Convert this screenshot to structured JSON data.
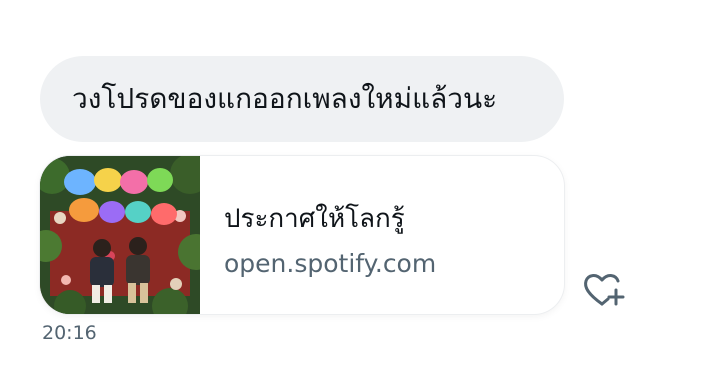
{
  "message": {
    "text": "วงโปรดของแกออกเพลงใหม่แล้วนะ"
  },
  "link_card": {
    "title": "ประกาศให้โลกรู้",
    "domain": "open.spotify.com",
    "thumbnail_icon": "album-cover-image"
  },
  "actions": {
    "react_icon": "heart-plus-icon"
  },
  "timestamp": "20:16",
  "colors": {
    "bubble_bg": "#eff1f3",
    "text": "#0f1419",
    "secondary_text": "#536471"
  }
}
